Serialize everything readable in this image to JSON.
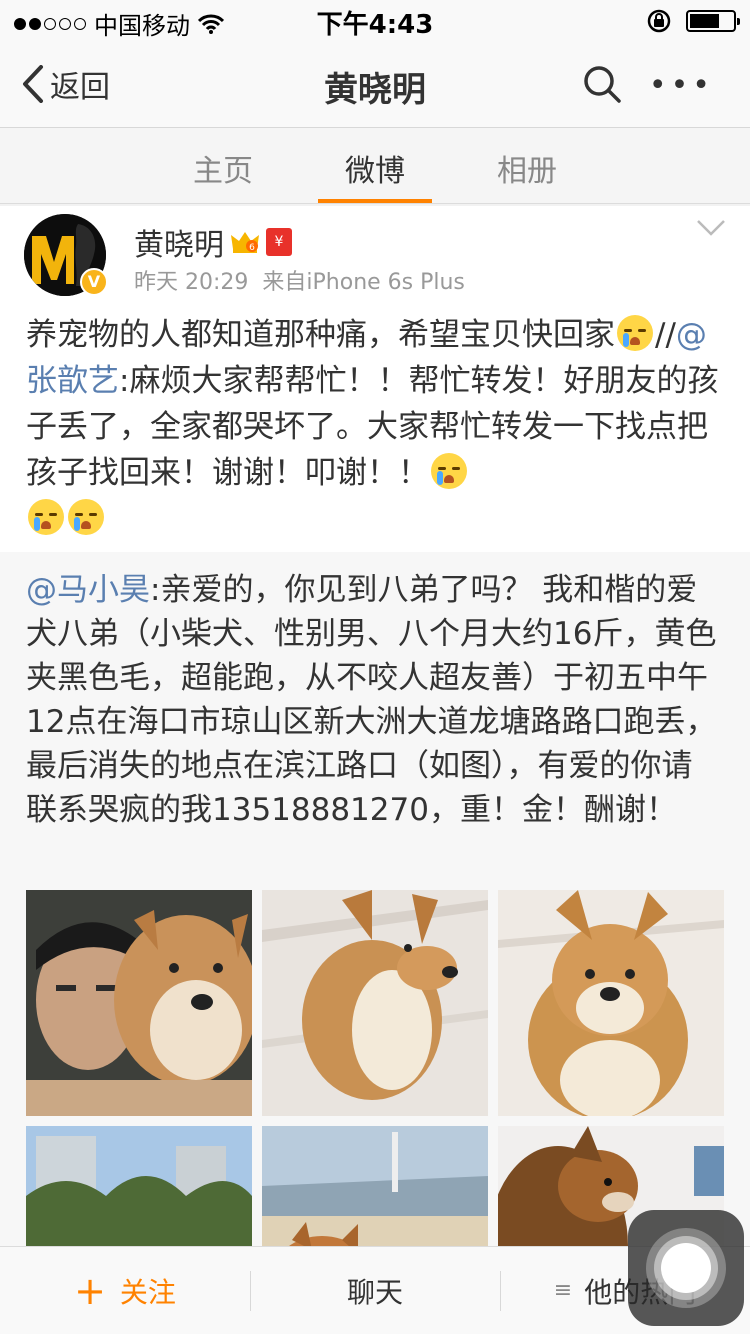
{
  "status_bar": {
    "carrier": "中国移动",
    "time": "下午4:43",
    "battery_level": 0.7
  },
  "nav": {
    "back_label": "返回",
    "title": "黄晓明"
  },
  "tabs": [
    {
      "label": "主页",
      "active": false
    },
    {
      "label": "微博",
      "active": true
    },
    {
      "label": "相册",
      "active": false
    }
  ],
  "post": {
    "author": "黄晓明",
    "time": "昨天 20:29",
    "source": "来自iPhone 6s Plus",
    "redpack_glyph": "¥",
    "verified_glyph": "V",
    "text_part1": "养宠物的人都知道那种痛，希望宝贝快回家",
    "slashes": "//",
    "mention": "@张歆艺",
    "text_part2": ":麻烦大家帮帮忙！！帮忙转发！好朋友的孩子丢了，全家都哭坏了。大家帮忙转发一下找点把孩子找回来！谢谢！叩谢！！"
  },
  "retweet": {
    "mention": "@马小昊",
    "text": ":亲爱的，你见到八弟了吗？ 我和楷的爱犬八弟（小柴犬、性别男、八个月大约16斤，黄色夹黑色毛，超能跑，从不咬人超友善）于初五中午12点在海口市琼山区新大洲大道龙塘路路口跑丢，最后消失的地点在滨江路口（如图），有爱的你请联系哭疯的我13518881270，重！金！酬谢！"
  },
  "bottom_bar": {
    "follow_label": "关注",
    "chat_label": "聊天",
    "hot_label": "他的热门"
  },
  "colors": {
    "accent": "#ff8200",
    "mention": "#5a7fb0"
  }
}
